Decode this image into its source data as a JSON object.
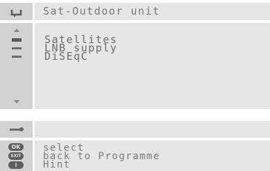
{
  "header": {
    "title": "Sat-Outdoor unit",
    "icon": "dish-back-icon"
  },
  "menu": {
    "items": [
      {
        "label": "Satellites"
      },
      {
        "label": "LNB supply"
      },
      {
        "label": "DiSEqC"
      }
    ]
  },
  "info": {
    "icon": "wrench-icon"
  },
  "help": {
    "lines": [
      {
        "key": "OK",
        "text": "select"
      },
      {
        "key": "EXIT",
        "text": "back to Programme"
      },
      {
        "key": "i",
        "text": "Hint"
      }
    ]
  }
}
